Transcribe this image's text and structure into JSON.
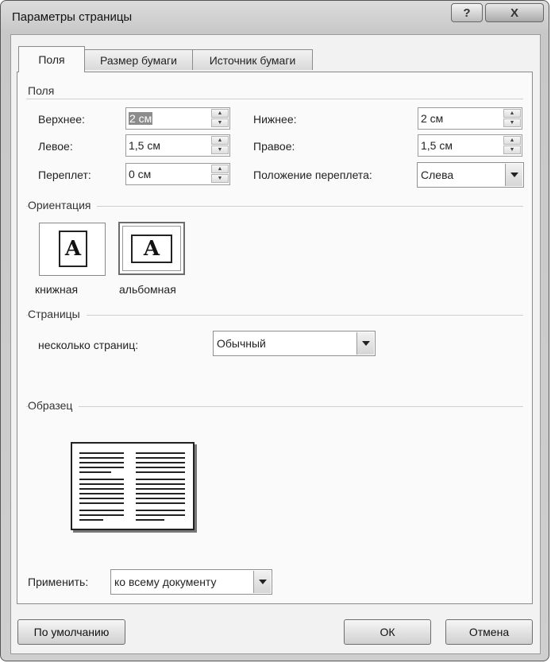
{
  "window": {
    "title": "Параметры страницы",
    "help_label": "?",
    "close_label": "X"
  },
  "tabs": [
    {
      "label": "Поля",
      "active": true
    },
    {
      "label": "Размер бумаги",
      "active": false
    },
    {
      "label": "Источник бумаги",
      "active": false
    }
  ],
  "margins": {
    "group_label": "Поля",
    "top_label": "Верхнее:",
    "top_value": "2 см",
    "bottom_label": "Нижнее:",
    "bottom_value": "2 см",
    "left_label": "Левое:",
    "left_value": "1,5 см",
    "right_label": "Правое:",
    "right_value": "1,5 см",
    "gutter_label": "Переплет:",
    "gutter_value": "0 см",
    "gutter_pos_label": "Положение переплета:",
    "gutter_pos_value": "Слева"
  },
  "orientation": {
    "group_label": "Ориентация",
    "portrait_label": "книжная",
    "landscape_label": "альбомная",
    "selected": "альбомная",
    "icon_letter": "A"
  },
  "pages": {
    "group_label": "Страницы",
    "multiple_label": "несколько страниц:",
    "multiple_value": "Обычный"
  },
  "sample": {
    "group_label": "Образец"
  },
  "apply": {
    "label": "Применить:",
    "value": "ко всему документу"
  },
  "buttons": {
    "default_label": "По умолчанию",
    "ok_label": "ОК",
    "cancel_label": "Отмена"
  }
}
